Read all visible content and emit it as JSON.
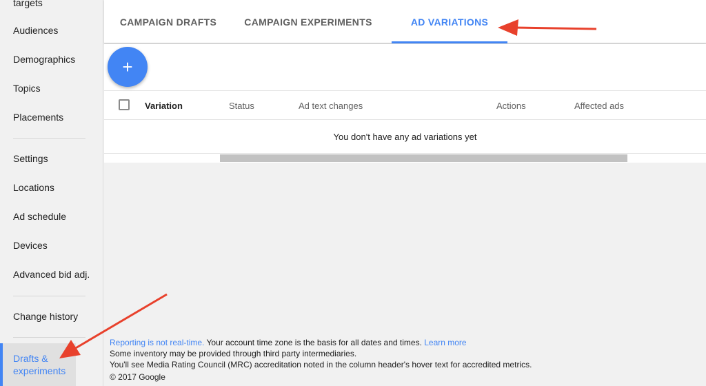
{
  "sidebar": {
    "items": [
      {
        "label": "targets"
      },
      {
        "label": "Audiences"
      },
      {
        "label": "Demographics"
      },
      {
        "label": "Topics"
      },
      {
        "label": "Placements"
      },
      {
        "label": "Settings"
      },
      {
        "label": "Locations"
      },
      {
        "label": "Ad schedule"
      },
      {
        "label": "Devices"
      },
      {
        "label": "Advanced bid adj."
      },
      {
        "label": "Change history"
      },
      {
        "label": "Drafts & experiments"
      }
    ]
  },
  "tabs": [
    {
      "label": "CAMPAIGN DRAFTS"
    },
    {
      "label": "CAMPAIGN EXPERIMENTS"
    },
    {
      "label": "AD VARIATIONS"
    }
  ],
  "fab": {
    "label": "+"
  },
  "table": {
    "columns": [
      "Variation",
      "Status",
      "Ad text changes",
      "Actions",
      "Affected ads"
    ],
    "empty_message": "You don't have any ad variations yet"
  },
  "footer": {
    "reporting_link": "Reporting is not real-time.",
    "timezone_text": " Your account time zone is the basis for all dates and times. ",
    "learn_more": "Learn more",
    "inventory_text": "Some inventory may be provided through third party intermediaries.",
    "mrc_text": "You'll see Media Rating Council (MRC) accreditation noted in the column header's hover text for accredited metrics.",
    "copyright": "© 2017 Google"
  },
  "colors": {
    "accent": "#4285f4",
    "annotation_arrow": "#e8412c"
  }
}
